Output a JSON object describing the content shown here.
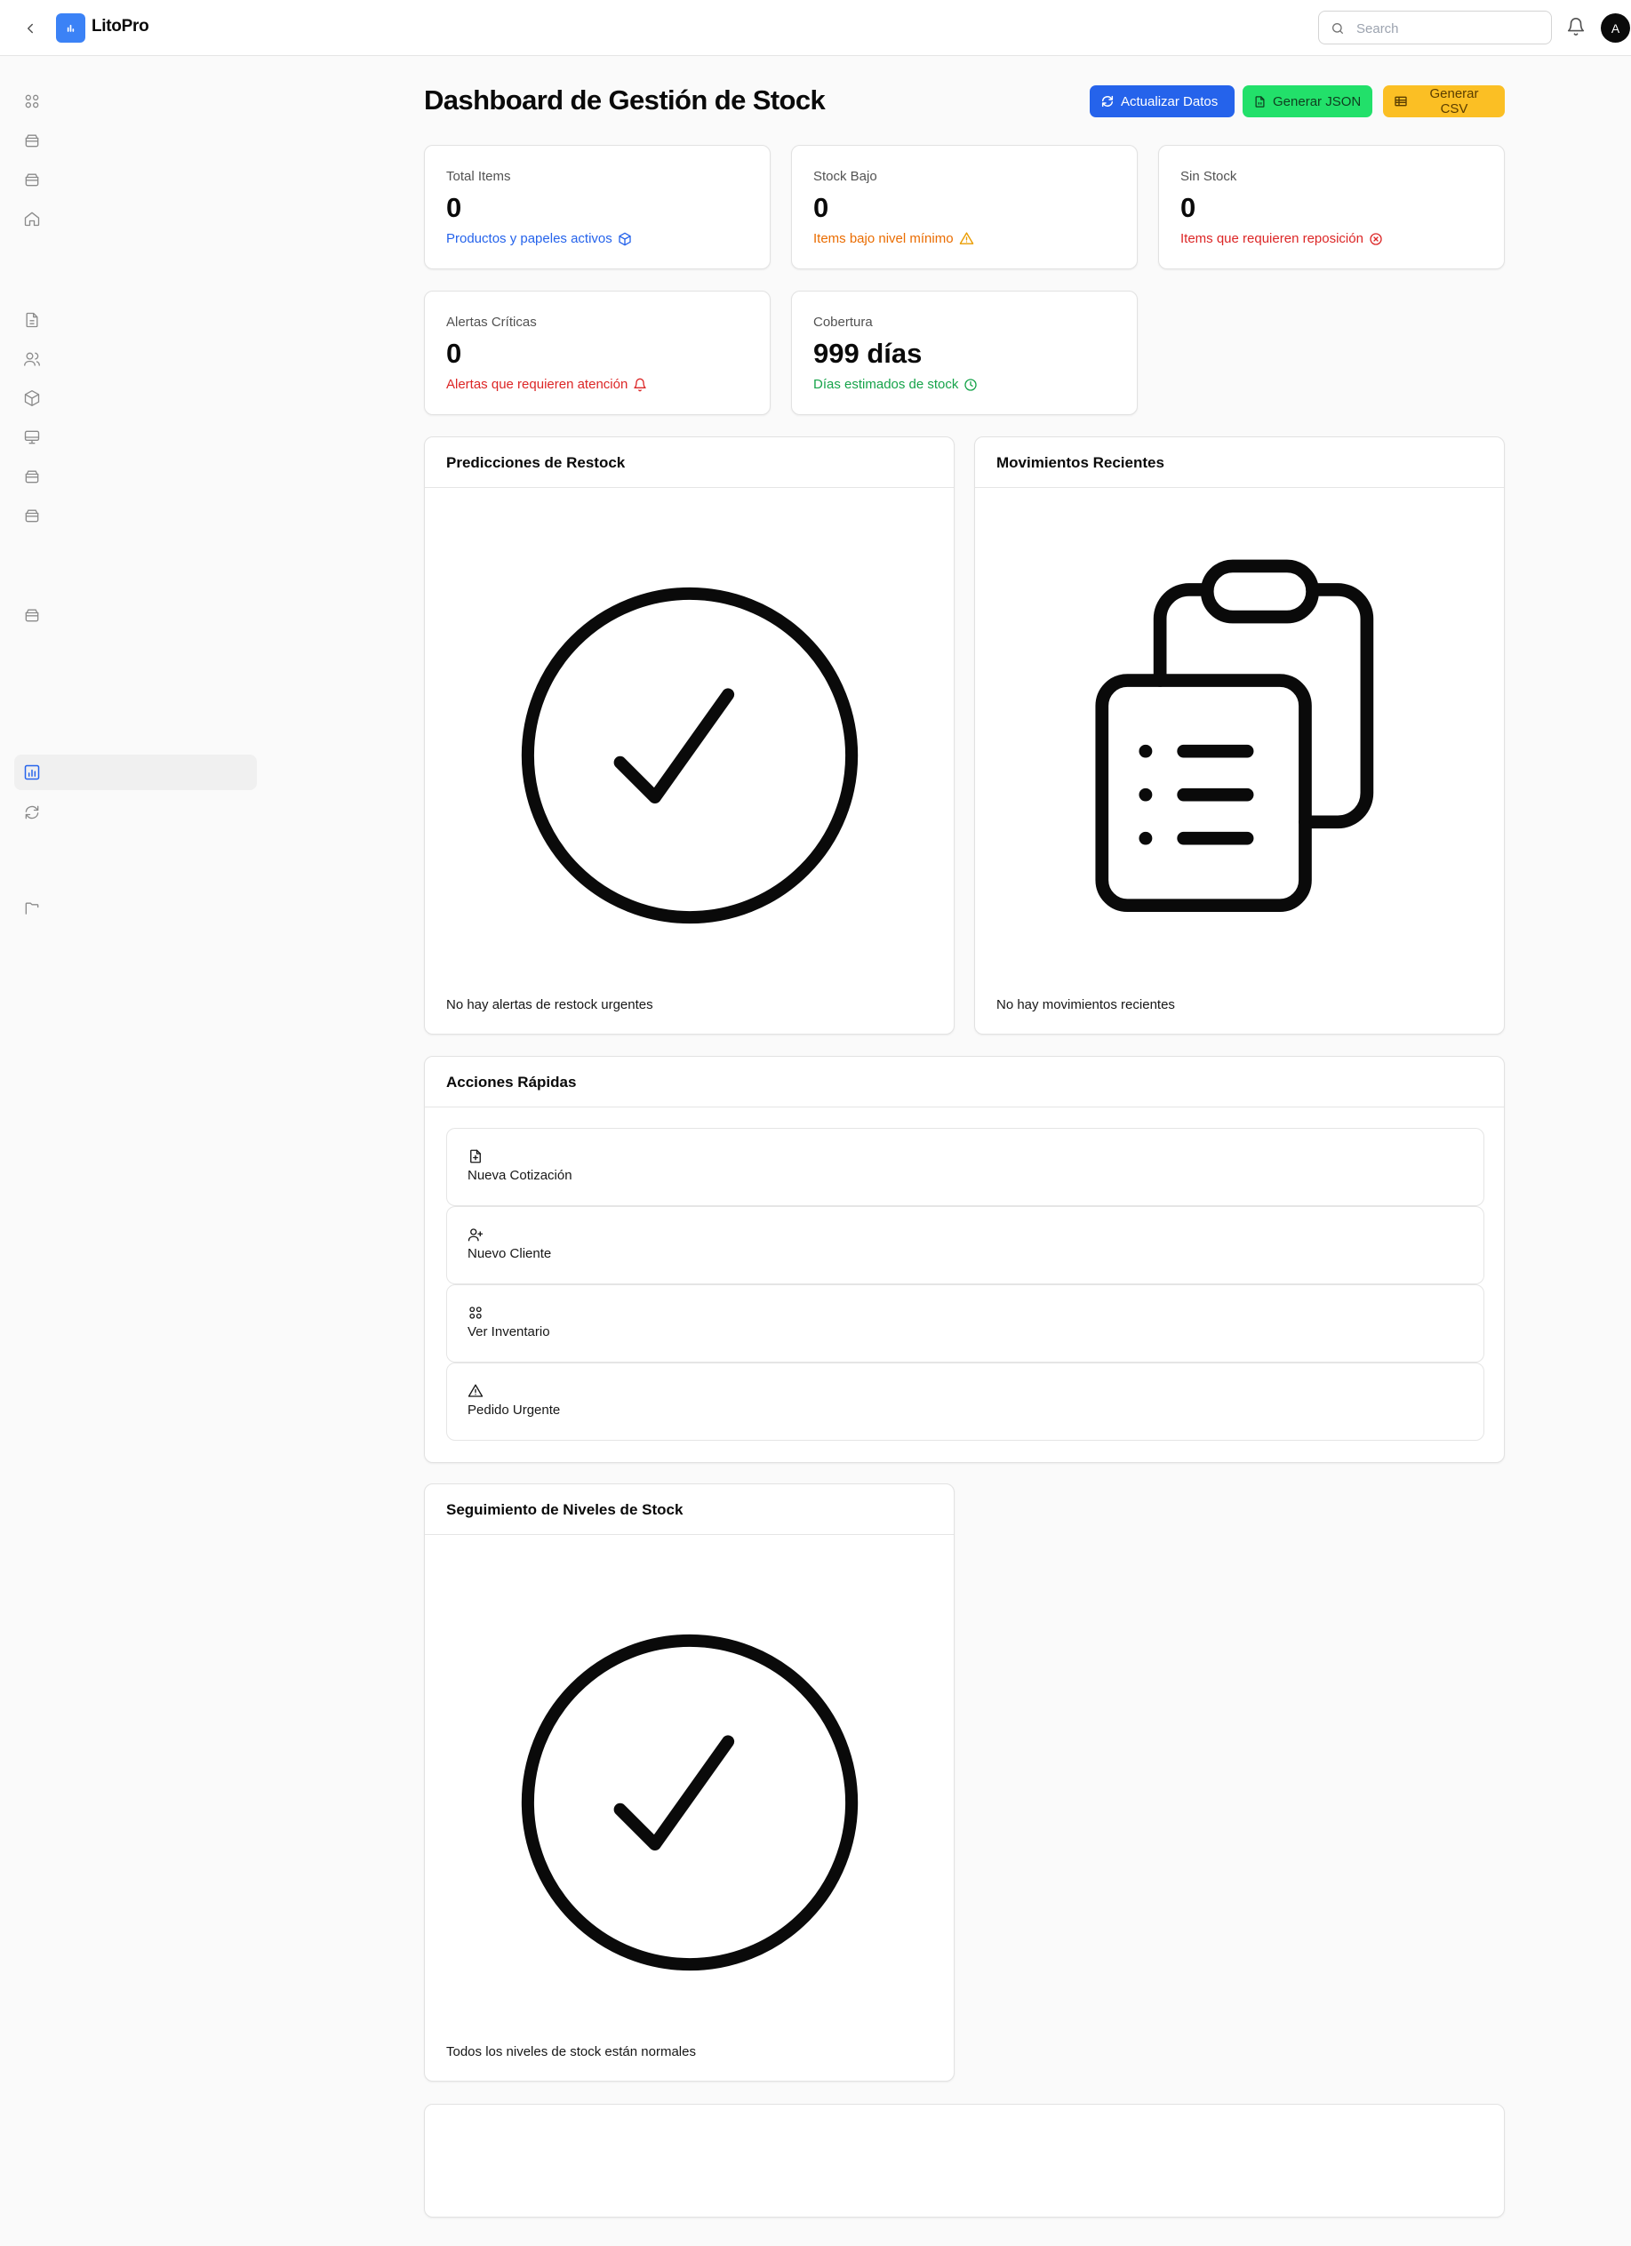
{
  "app": {
    "brand": "LitoPro",
    "search_placeholder": "Search",
    "avatar_initial": "A"
  },
  "sidebar": {
    "icons": [
      "grid-icon",
      "archive-icon",
      "archive-icon",
      "home-icon",
      "document-icon",
      "users-icon",
      "box-icon",
      "monitor-icon",
      "archive-icon",
      "archive-icon",
      "archive-icon",
      "chart-icon",
      "refresh-icon",
      "folder-icon"
    ],
    "active_item": "chart-icon"
  },
  "header": {
    "title": "Dashboard de Gestión de Stock",
    "buttons": {
      "refresh": "Actualizar Datos",
      "json": "Generar JSON",
      "csv": "Generar CSV"
    }
  },
  "stats": [
    {
      "label": "Total Items",
      "value": "0",
      "sub": "Productos y papeles activos",
      "color": "#2563eb",
      "icon": "cube-icon"
    },
    {
      "label": "Stock Bajo",
      "value": "0",
      "sub": "Items bajo nivel mínimo",
      "color": "#ea6c00",
      "icon": "warning-icon"
    },
    {
      "label": "Sin Stock",
      "value": "0",
      "sub": "Items que requieren reposición",
      "color": "#dc2626",
      "icon": "x-circle-icon"
    },
    {
      "label": "Alertas Críticas",
      "value": "0",
      "sub": "Alertas que requieren atención",
      "color": "#dc2626",
      "icon": "bell-icon"
    },
    {
      "label": "Cobertura",
      "value": "999 días",
      "sub": "Días estimados de stock",
      "color": "#16a34a",
      "icon": "clock-icon"
    }
  ],
  "panels": {
    "restock": {
      "title": "Predicciones de Restock",
      "empty": "No hay alertas de restock urgentes",
      "icon": "check-circle-icon"
    },
    "movements": {
      "title": "Movimientos Recientes",
      "empty": "No hay movimientos recientes",
      "icon": "clipboard-list-icon"
    },
    "quick_actions": {
      "title": "Acciones Rápidas",
      "items": [
        {
          "label": "Nueva Cotización",
          "icon": "document-plus-icon"
        },
        {
          "label": "Nuevo Cliente",
          "icon": "user-plus-icon"
        },
        {
          "label": "Ver Inventario",
          "icon": "grid-icon"
        },
        {
          "label": "Pedido Urgente",
          "icon": "warning-icon"
        }
      ]
    },
    "stock_levels": {
      "title": "Seguimiento de Niveles de Stock",
      "empty": "Todos los niveles de stock están normales",
      "icon": "check-circle-icon"
    }
  }
}
